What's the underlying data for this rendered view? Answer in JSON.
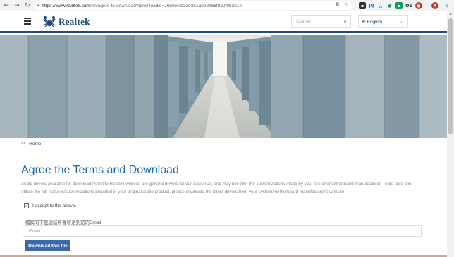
{
  "browser": {
    "url_host": "https://www.realtek.com",
    "url_path": "/en/agree-to-download?downloadid=7650efcb3303e1a0b2a68f8694f6221e",
    "back_icon": "arrow-left-icon",
    "forward_icon": "arrow-right-icon",
    "reload_icon": "reload-icon",
    "ext_jq": "JQ",
    "ext_os": "OS",
    "ext_a": "A"
  },
  "header": {
    "logo_text": "Realtek",
    "search_placeholder": "Search ...",
    "language": "English",
    "brand_color": "#1e4a7d"
  },
  "breadcrumb": {
    "home": "Home"
  },
  "main": {
    "title": "Agree the Terms and Download",
    "description": "Audio drivers available for download from the Realtek website are general drivers for our audio ICs, and may not offer the customizations made by your system/motherboard manufacturer. To be sure you obtain the full features/customizations provided in your original audio product, please download the latest drivers from your system/motherboard manufacturer's website.",
    "accept_label": "I accept to the above.",
    "accept_checked": true,
    "email_label": "檔案的下載連結將會發送到您的Email",
    "email_placeholder": "Email",
    "download_button": "Download this file"
  }
}
